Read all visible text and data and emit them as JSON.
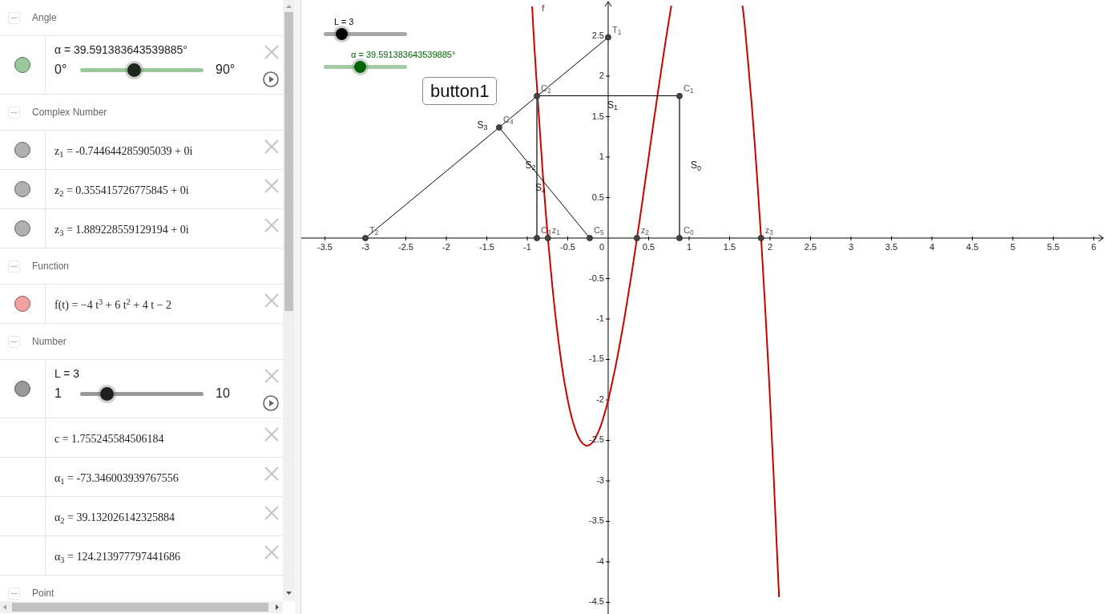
{
  "algebra": {
    "groups": [
      {
        "title": "Angle",
        "expanded": true,
        "items": [
          {
            "kind": "slider",
            "text": "α = 39.591383643539885°",
            "color": "#99c99a",
            "min": "0°",
            "max": "90°",
            "level": 0.44
          }
        ]
      },
      {
        "title": "Complex Number",
        "expanded": true,
        "items": [
          {
            "kind": "value",
            "text": "z$_{1}$ = -0.744644285905039 + 0i",
            "color": "#b0b0b0"
          },
          {
            "kind": "value",
            "text": "z$_{2}$ = 0.355415726775845 + 0i",
            "color": "#b0b0b0"
          },
          {
            "kind": "value",
            "text": "z$_{3}$ = 1.889228559129194 + 0i",
            "color": "#b0b0b0"
          }
        ]
      },
      {
        "title": "Function",
        "expanded": true,
        "items": [
          {
            "kind": "value",
            "text": "f(t) = −4 t$^{3}$ + 6 t$^{2}$ + 4 t − 2",
            "color": "#f2a0a0"
          }
        ]
      },
      {
        "title": "Number",
        "expanded": true,
        "items": [
          {
            "kind": "slider",
            "text": "L = 3",
            "color": "#999999",
            "min": "1",
            "max": "10",
            "level": 0.222
          },
          {
            "kind": "value",
            "text": "c = 1.755245584506184"
          },
          {
            "kind": "value",
            "text": "α$_{1}$ = -73.346003939767556"
          },
          {
            "kind": "value",
            "text": "α$_{2}$ = 39.132026142325884"
          },
          {
            "kind": "value",
            "text": "α$_{3}$ = 124.213977797441686"
          }
        ]
      },
      {
        "title": "Point",
        "expanded": true
      }
    ]
  },
  "graphics": {
    "sliders": [
      {
        "label": "L = 3",
        "level": 0.222,
        "color": "#000000"
      },
      {
        "label": "α = 39.591383643539885°",
        "level": 0.44,
        "color": "#006400"
      }
    ],
    "button": "button1",
    "segments": [
      {
        "label": "S$_{3}$",
        "color": "#000000"
      },
      {
        "label": "S$_{1}$",
        "color": "#000000"
      },
      {
        "label": "S$_{0}$",
        "color": "#666666"
      },
      {
        "label": "S$_{4}$",
        "color": "#666666"
      },
      {
        "label": "S$_{2}$",
        "color": "#000000"
      }
    ],
    "points": [
      {
        "label": "T$_{1}$"
      },
      {
        "label": "T$_{2}$"
      },
      {
        "label": "C$_{2}$"
      },
      {
        "label": "C$_{1}$"
      },
      {
        "label": "C$_{4}$"
      },
      {
        "label": "C$_{3}$"
      },
      {
        "label": "z$_{1}$"
      },
      {
        "label": "C$_{5}$"
      },
      {
        "label": "z$_{2}$"
      },
      {
        "label": "C$_{0}$"
      },
      {
        "label": "z$_{3}$"
      }
    ],
    "chart_data": {
      "type": "line",
      "xlim": [
        -3.792,
        6.139
      ],
      "ylim": [
        -4.644,
        2.941
      ],
      "xticks": [
        -3.5,
        -3,
        -2.5,
        -2,
        -1.5,
        -1,
        -0.5,
        0,
        0.5,
        1,
        1.5,
        2,
        2.5,
        3,
        3.5,
        4,
        4.5,
        5,
        5.5,
        6
      ],
      "yticks": [
        2.5,
        2,
        1.5,
        1,
        0.5,
        -0.5,
        -1,
        -1.5,
        -2,
        -2.5,
        -3,
        -3.5,
        -4,
        -4.5
      ],
      "x": [
        -0.94,
        -0.9,
        -0.8,
        -0.7,
        -0.6,
        -0.5,
        -0.4,
        -0.3,
        -0.2,
        -0.1,
        0,
        0.1,
        0.2,
        0.3,
        0.4,
        0.5,
        0.6,
        0.7,
        0.78,
        1.2,
        1.66,
        1.7,
        1.8,
        1.9,
        2.0,
        2.1,
        2.11
      ],
      "series": [
        {
          "name": "f",
          "color": "#cc0000",
          "values": [
            2.86,
            2.18,
            0.69,
            -0.49,
            -1.38,
            -2,
            -2.38,
            -2.55,
            -2.53,
            -2.34,
            -2,
            -1.54,
            -0.99,
            -0.37,
            0.3,
            1,
            1.7,
            2.37,
            2.87,
            null,
            2.87,
            2.49,
            1.31,
            -0.18,
            -2,
            -4.18,
            -4.42
          ]
        }
      ]
    }
  }
}
